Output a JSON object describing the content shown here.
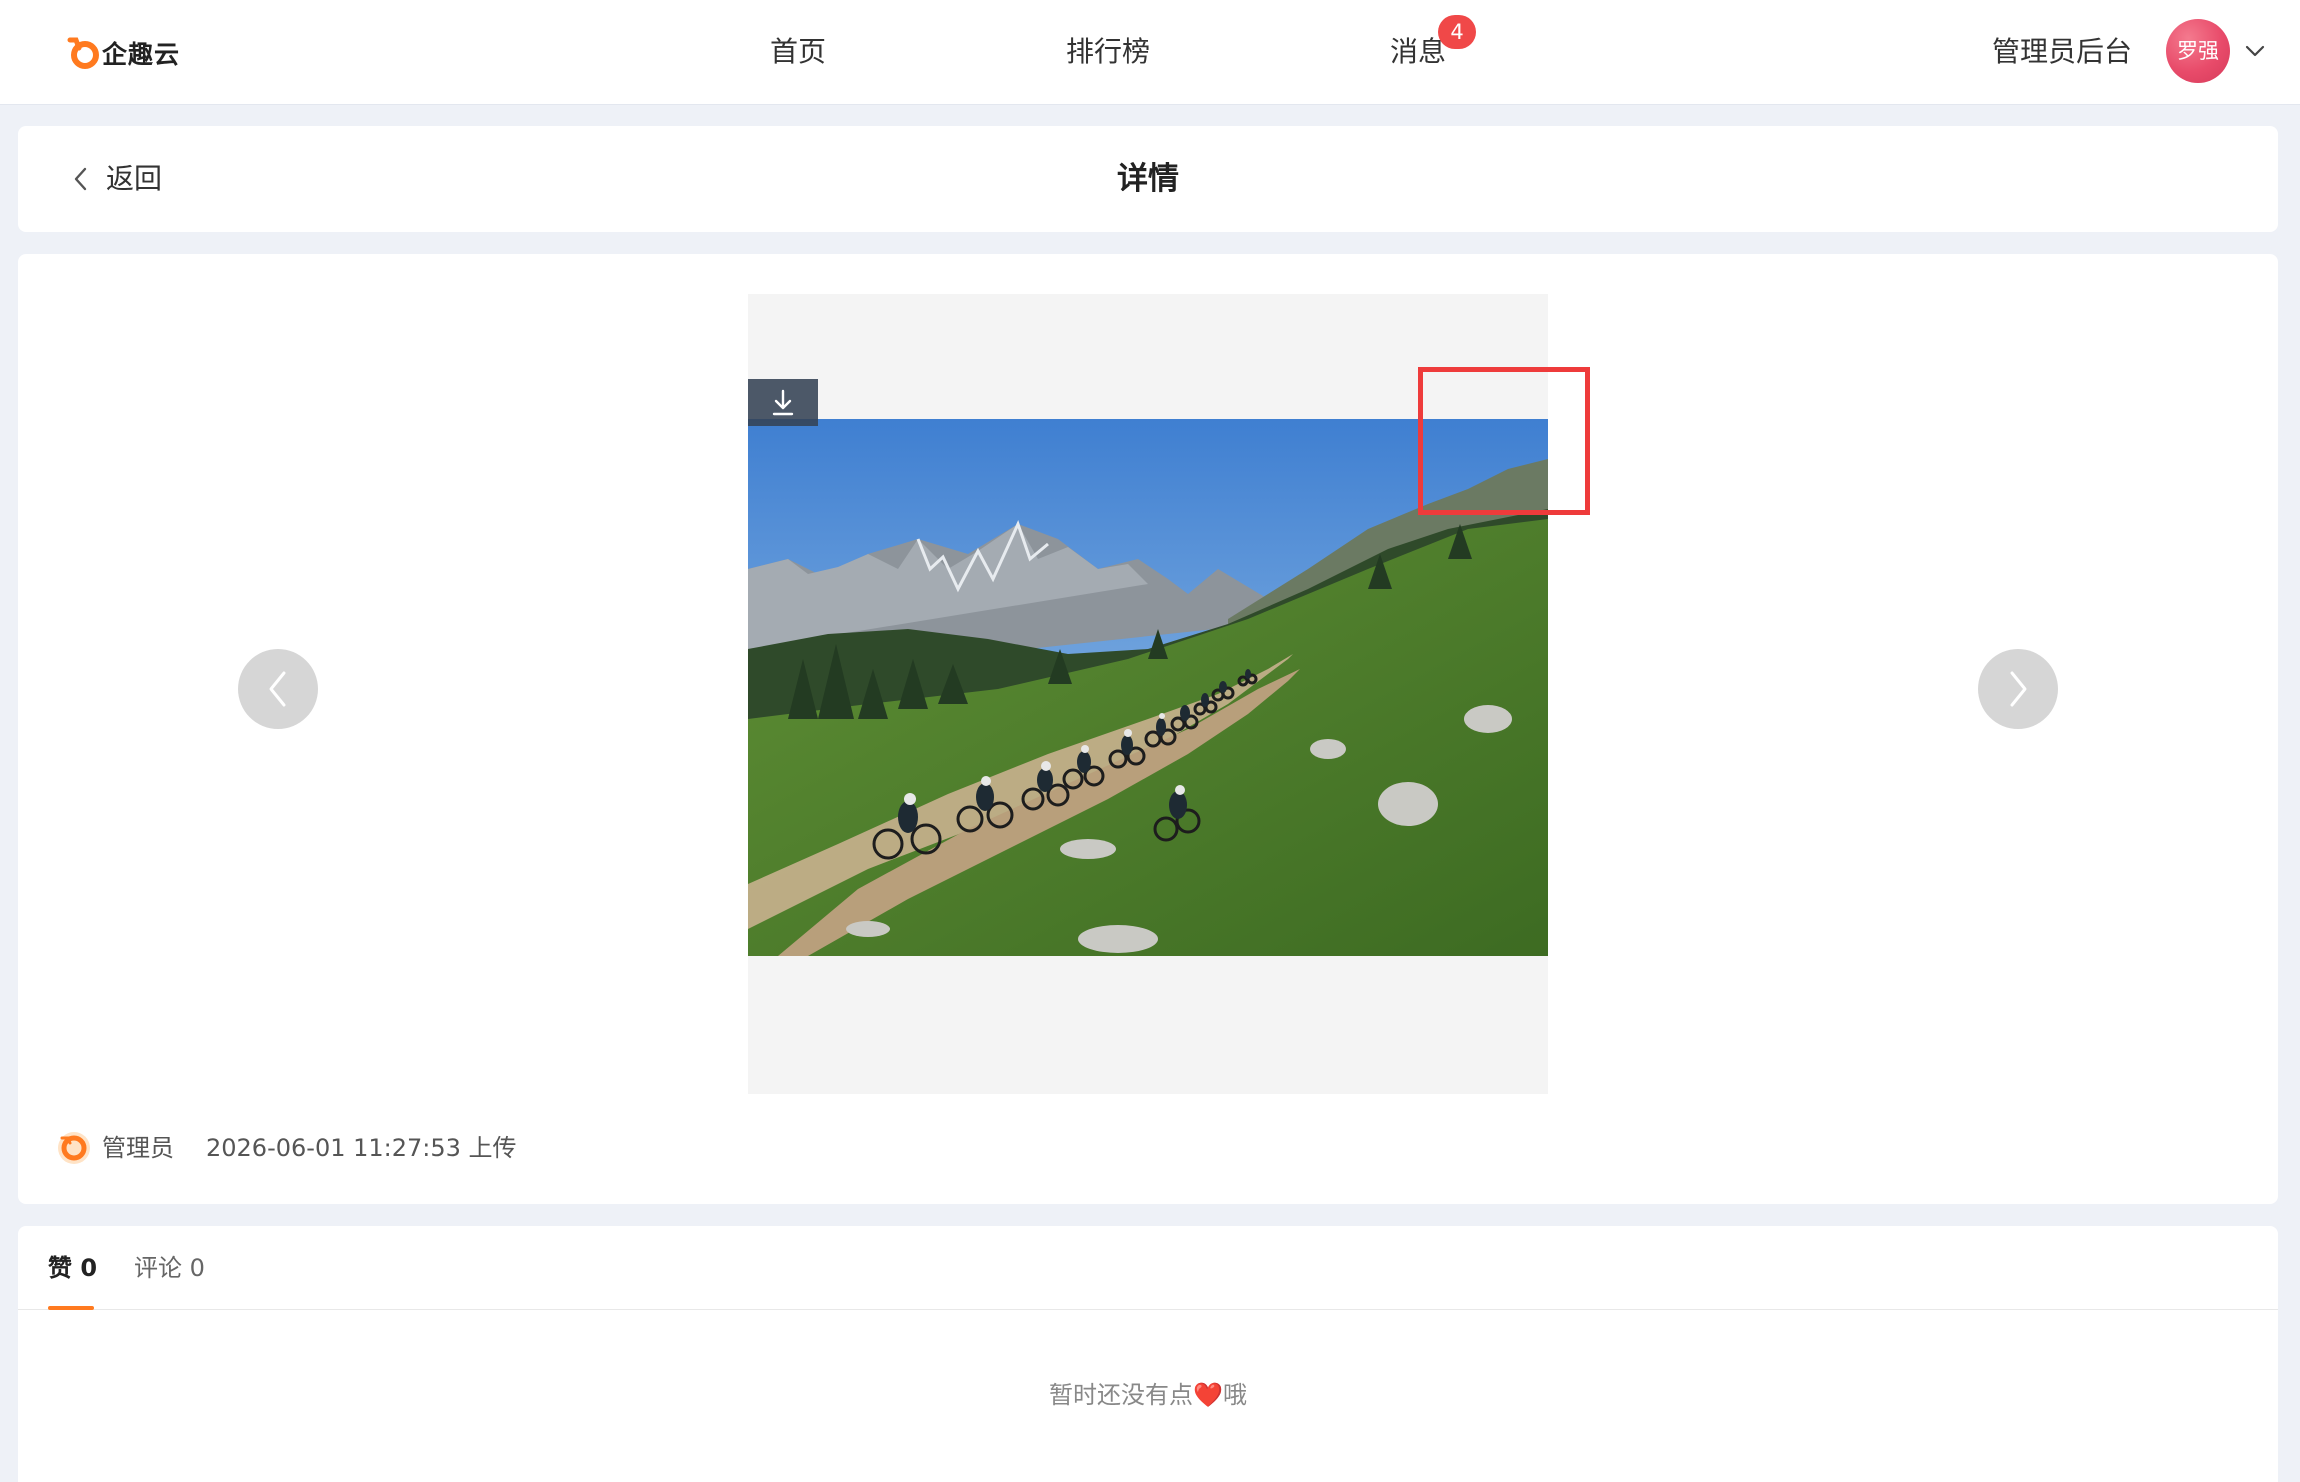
{
  "nav": {
    "logo_text": "企趣云",
    "items": [
      {
        "label": "首页"
      },
      {
        "label": "排行榜"
      },
      {
        "label": "消息"
      }
    ],
    "message_badge": "4",
    "admin_link": "管理员后台",
    "user_avatar_text": "罗强"
  },
  "header": {
    "back_label": "返回",
    "title": "详情"
  },
  "photo": {
    "uploader": "管理员",
    "upload_time": "2026-06-01 11:27:53 上传"
  },
  "tabs": [
    {
      "label": "赞 0",
      "active": true
    },
    {
      "label": "评论 0",
      "active": false
    }
  ],
  "empty": {
    "text_before": "暂时还没有点",
    "heart": "❤️",
    "text_after": "哦"
  },
  "colors": {
    "brand_orange": "#ff7a1f",
    "badge_red": "#f04848",
    "highlight_red": "#ee3b3b",
    "page_bg": "#eef1f7"
  },
  "icons": [
    "logo-icon",
    "chevron-down-icon",
    "chevron-left-icon",
    "download-icon",
    "arrow-left-icon",
    "arrow-right-icon",
    "uploader-icon",
    "heart-icon"
  ]
}
